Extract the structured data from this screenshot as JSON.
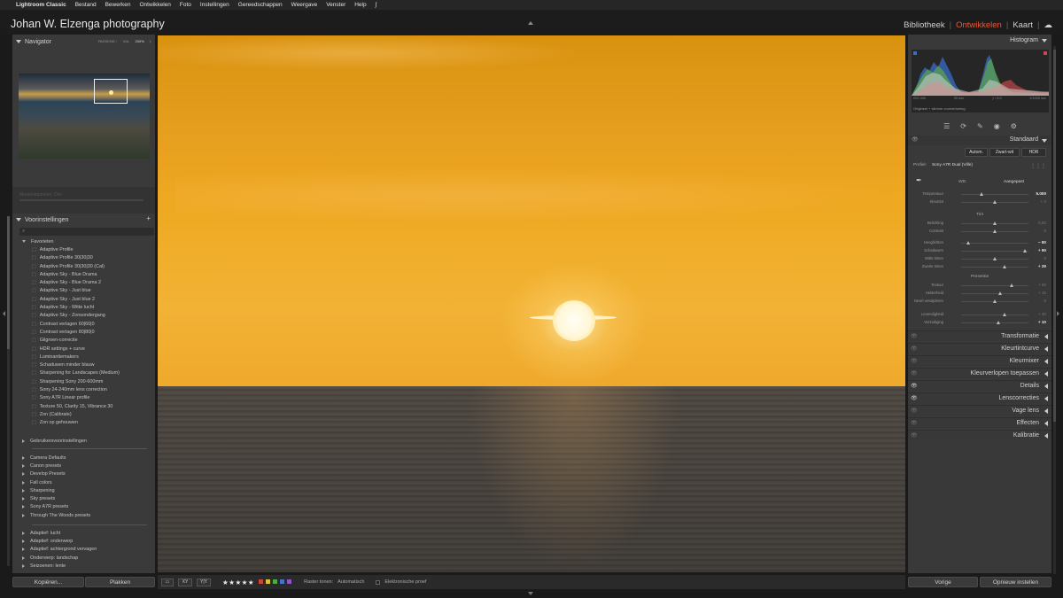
{
  "menubar": {
    "apple_icon": "",
    "app": "Lightroom Classic",
    "items": [
      "Bestand",
      "Bewerken",
      "Ontwikkelen",
      "Foto",
      "Instellingen",
      "Gereedschappen",
      "Weergave",
      "Venster",
      "Help"
    ],
    "script_icon": "ʃ"
  },
  "identity": "Johan W. Elzenga photography",
  "modules": {
    "library": "Bibliotheek",
    "develop": "Ontwikkelen",
    "map": "Kaart",
    "sep": "|",
    "cloud_icon": "☁",
    "active_color": "#e25a3b"
  },
  "left": {
    "navigator_title": "Navigator",
    "zoom_options": [
      "PASSEND ↑",
      "VUL",
      "200%"
    ],
    "zoom_active": "200%",
    "zoom_more": "‡",
    "empty_title": "Momentopname: Ovn",
    "presets_title": "Voorinstellingen",
    "presets_add": "+",
    "search_icon": "⌕",
    "favorites_label": "Favorieten",
    "favorites": [
      "Adaptive Profile",
      "Adaptive Profile 30|30|30",
      "Adaptive Profile 30|30|30 (Cal)",
      "Adaptive Sky - Blue Drama",
      "Adaptive Sky - Blue Drama 2",
      "Adaptive Sky - Just blue",
      "Adaptive Sky - Just blue 2",
      "Adaptive Sky - Witte lucht",
      "Adaptive Sky - Zonsondergang",
      "Contrast verlagen 60|60|0",
      "Contrast verlagen 80|80|0",
      "Gilgroen-correctie",
      "HDR settings + curve",
      "Luminantiemakers",
      "Schaduwen minder blauw",
      "Sharpening for Landscapes (Medium)",
      "Sharpening Sony 200-600mm",
      "Sony 24-240mm lens correction",
      "Sony A7R Linear profile",
      "Texture 50, Clarity 15, Vibrance 30",
      "Zon (Calibrate)",
      "Zon op gehouwen"
    ],
    "user_group": "Gebruikersvoorinstellingen",
    "groups_a": [
      "Camera Defaults",
      "Canon presets",
      "Develop Presets",
      "Fall colors",
      "Sharpening",
      "Sky presets",
      "Sony A7R presets",
      "Through The Woods presets"
    ],
    "groups_b": [
      "Adaptief: lucht",
      "Adaptief: onderwerp",
      "Adaptief: achtergrond vervagen",
      "Onderwerp: landschap",
      "Seizoenen: lente"
    ],
    "copy_label": "Kopiëren...",
    "paste_label": "Plakken"
  },
  "toolbar": {
    "view_loupe_icon": "▭",
    "view_compare": "XY",
    "view_survey": "Y|Y",
    "stars": "★★★★★",
    "color_labels": [
      "#c9453f",
      "#d9c33a",
      "#4fa84a",
      "#4575c2",
      "#8e57c2"
    ],
    "raster_label": "Raster tonen:",
    "raster_value": "Automatisch",
    "softproof_label": "Elektronische proef"
  },
  "right": {
    "histogram_title": "Histogram",
    "hist_info": [
      "ISO 400",
      "39 mm",
      "ƒ / 8,0",
      "1/1000 sec"
    ],
    "hist_orig": "Origineel + slimme voorvertoning",
    "tool_icons": [
      "☰",
      "⟳",
      "✎",
      "◉",
      "⚙"
    ],
    "basic_title": "Standaard",
    "treatment": [
      "Autom.",
      "Zwart-wit",
      "HDR"
    ],
    "profile_label": "Profiel:",
    "profile_value": "Sony A7R Dual (Ville)",
    "profile_grid_icon": "⋮⋮⋮",
    "wb_label": "WB:",
    "wb_value": "Aangepast",
    "wb_picker_icon": "✒",
    "tone_label": "Tint",
    "presence_label": "Presentie",
    "sliders_wb": [
      {
        "name": "Temperatuur",
        "value": "5.000",
        "pos": 0.3,
        "strong": true
      },
      {
        "name": "Kleurtint",
        "value": "+ 0",
        "pos": 0.5,
        "strong": false
      }
    ],
    "sliders_tone": [
      {
        "name": "Belichting",
        "value": "0,00",
        "pos": 0.5,
        "strong": false
      },
      {
        "name": "Contrast",
        "value": "0",
        "pos": 0.5,
        "strong": false
      },
      {
        "name": "Hooglichten",
        "value": "− 80",
        "pos": 0.1,
        "strong": true
      },
      {
        "name": "Schaduwen",
        "value": "+ 90",
        "pos": 0.95,
        "strong": true
      },
      {
        "name": "Witte tinten",
        "value": "0",
        "pos": 0.5,
        "strong": false
      },
      {
        "name": "Zwarte tinten",
        "value": "+ 29",
        "pos": 0.65,
        "strong": true
      }
    ],
    "sliders_presence": [
      {
        "name": "Textuur",
        "value": "+ 50",
        "pos": 0.75,
        "strong": false
      },
      {
        "name": "Helderheid",
        "value": "+ 15",
        "pos": 0.58,
        "strong": false
      },
      {
        "name": "Nevel verwijderen",
        "value": "0",
        "pos": 0.5,
        "strong": false
      },
      {
        "name": "Levendigheid",
        "value": "+ 30",
        "pos": 0.65,
        "strong": false
      },
      {
        "name": "Verzadiging",
        "value": "+ 10",
        "pos": 0.55,
        "strong": true
      }
    ],
    "panels": [
      {
        "label": "Transformatie",
        "eye_on": false
      },
      {
        "label": "Kleurtintcurve",
        "eye_on": false
      },
      {
        "label": "Kleurmixer",
        "eye_on": false
      },
      {
        "label": "Kleurverlopen toepassen",
        "eye_on": false
      },
      {
        "label": "Details",
        "eye_on": true
      },
      {
        "label": "Lenscorrecties",
        "eye_on": true
      },
      {
        "label": "Vage lens",
        "eye_on": false
      },
      {
        "label": "Effecten",
        "eye_on": false
      },
      {
        "label": "Kalibratie",
        "eye_on": false
      }
    ],
    "eye_icon": "👁",
    "prev_label": "Vorige",
    "reset_label": "Opnieuw instellen"
  }
}
